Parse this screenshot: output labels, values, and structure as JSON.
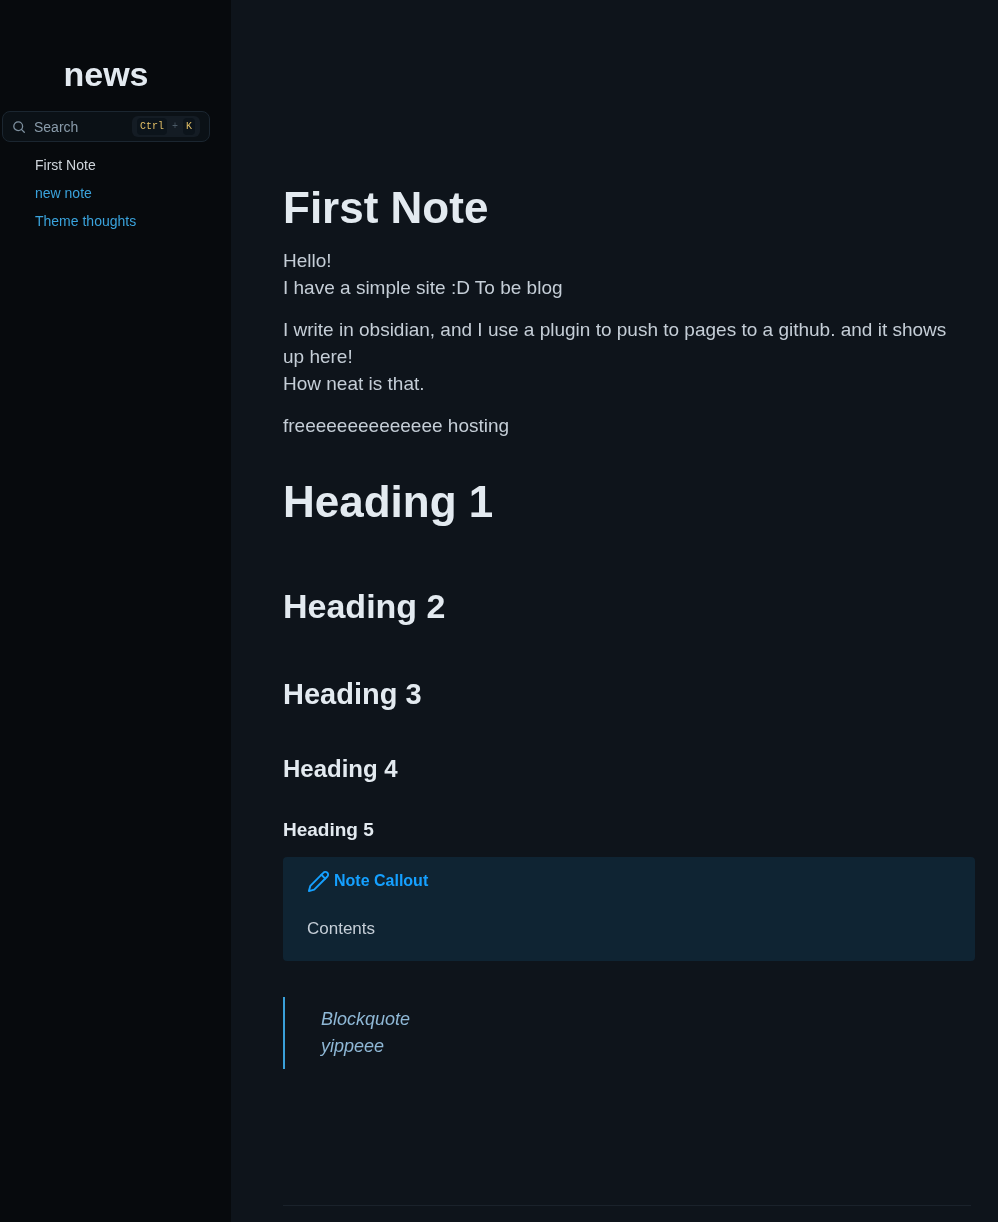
{
  "sidebar": {
    "title": "news",
    "search": {
      "placeholder": "Search",
      "keys": [
        "Ctrl",
        "K"
      ],
      "separator": "+"
    },
    "items": [
      {
        "label": "First Note",
        "selected": true
      },
      {
        "label": "new note",
        "selected": false
      },
      {
        "label": "Theme thoughts",
        "selected": false
      }
    ]
  },
  "content": [
    {
      "kind": "title",
      "text": "First Note"
    },
    {
      "kind": "paragraph",
      "lines": [
        "Hello!",
        "I have a simple site :D To be blog"
      ]
    },
    {
      "kind": "paragraph",
      "lines": [
        "I write in obsidian, and I use a plugin to push to pages to a github. and it shows up here!",
        "How neat is that."
      ]
    },
    {
      "kind": "paragraph",
      "lines": [
        "freeeeeeeeeeeeee hosting"
      ]
    },
    {
      "kind": "h1",
      "text": "Heading 1"
    },
    {
      "kind": "h2",
      "text": "Heading 2"
    },
    {
      "kind": "h3",
      "text": "Heading 3"
    },
    {
      "kind": "h4",
      "text": "Heading 4"
    },
    {
      "kind": "h5",
      "text": "Heading 5"
    },
    {
      "kind": "callout",
      "title": "Note Callout",
      "body": "Contents"
    },
    {
      "kind": "blockquote",
      "lines": [
        "Blockquote",
        "yippeee"
      ]
    }
  ]
}
